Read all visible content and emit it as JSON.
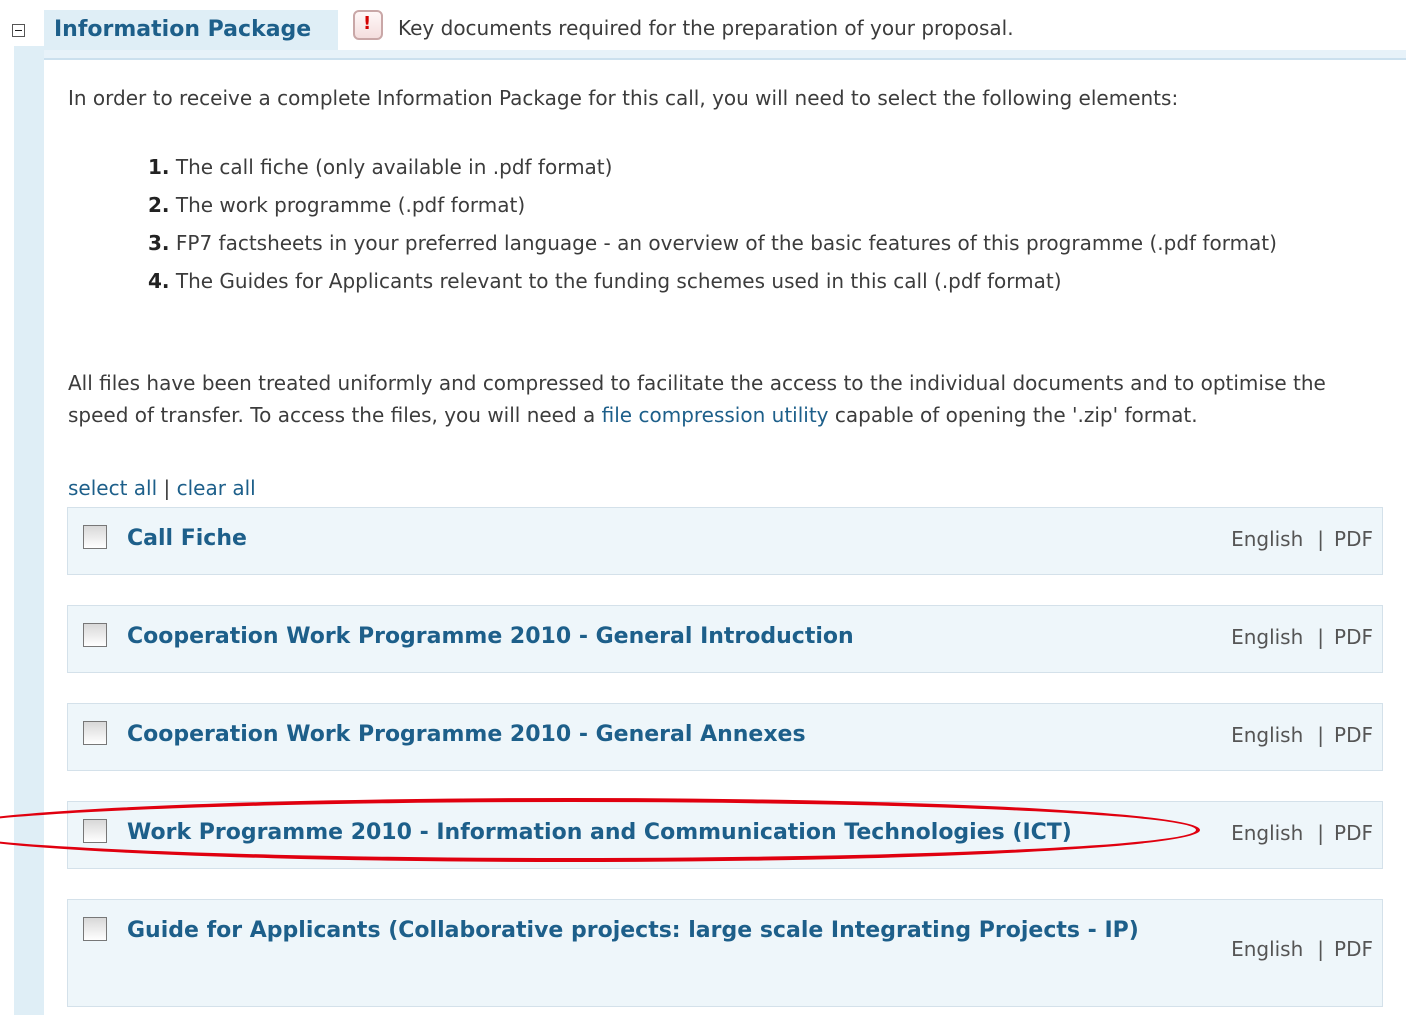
{
  "section": {
    "toggle_icon": "collapse-minus-icon",
    "title": "Information Package",
    "alert_icon": "exclamation-icon",
    "alert_symbol": "!",
    "description": "Key documents required for the preparation of your proposal."
  },
  "intro": "In order to receive a complete Information Package for this call, you will need to select the following elements:",
  "steps": [
    {
      "num": "1.",
      "text": "The call fiche (only available in .pdf format)"
    },
    {
      "num": "2.",
      "text": "The work programme (.pdf format)"
    },
    {
      "num": "3.",
      "text": "FP7 factsheets in your preferred language - an overview of the basic features of this programme (.pdf format)"
    },
    {
      "num": "4.",
      "text": "The Guides for Applicants relevant to the funding schemes used in this call (.pdf format)"
    }
  ],
  "paragraph": {
    "before_link": "All files have been treated uniformly and compressed to facilitate the access to the individual documents and to optimise the speed of transfer. To access the files, you will need a ",
    "link": "file compression utility",
    "after_link": " capable of opening the '.zip' format."
  },
  "selection": {
    "select_all": "select all",
    "separator": "|",
    "clear_all": "clear all"
  },
  "documents": [
    {
      "title": "Call Fiche",
      "language": "English",
      "separator": "|",
      "format": "PDF",
      "checked": false
    },
    {
      "title": "Cooperation Work Programme 2010 - General Introduction",
      "language": "English",
      "separator": "|",
      "format": "PDF",
      "checked": false
    },
    {
      "title": "Cooperation Work Programme 2010 - General Annexes",
      "language": "English",
      "separator": "|",
      "format": "PDF",
      "checked": false
    },
    {
      "title": "Work Programme 2010 - Information and Communication Technologies (ICT)",
      "language": "English",
      "separator": "|",
      "format": "PDF",
      "checked": false
    },
    {
      "title": "Guide for Applicants (Collaborative projects: large scale Integrating Projects - IP)",
      "language": "English",
      "separator": "|",
      "format": "PDF",
      "checked": false
    }
  ],
  "highlight_color": "#e0000f",
  "accent_color": "#1d5f8a"
}
